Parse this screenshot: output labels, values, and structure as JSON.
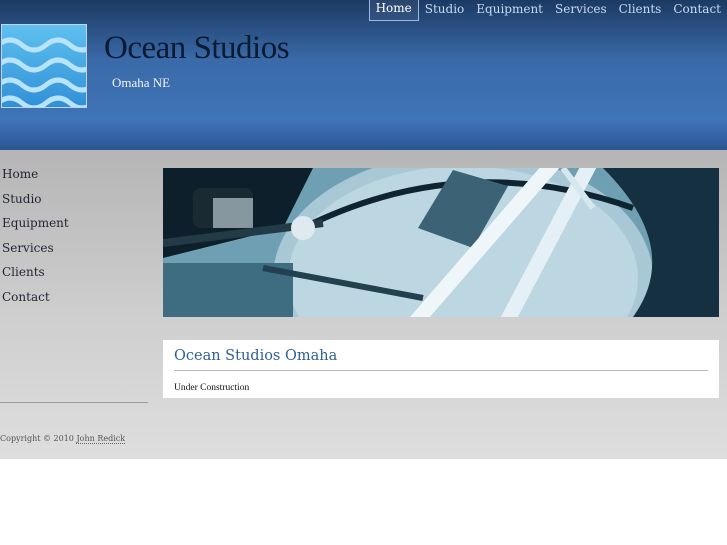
{
  "top_nav": [
    {
      "label": "Home",
      "active": true
    },
    {
      "label": "Studio"
    },
    {
      "label": "Equipment"
    },
    {
      "label": "Services"
    },
    {
      "label": "Clients"
    },
    {
      "label": "Contact"
    }
  ],
  "site": {
    "title": "Ocean Studios",
    "subtitle": "Omaha NE",
    "logo": "ocean-waves-logo"
  },
  "side_nav": [
    {
      "label": "Home"
    },
    {
      "label": "Studio"
    },
    {
      "label": "Equipment"
    },
    {
      "label": "Services"
    },
    {
      "label": "Clients"
    },
    {
      "label": "Contact"
    }
  ],
  "banner": {
    "image": "drum-kit-photo"
  },
  "main": {
    "heading": "Ocean Studios Omaha",
    "body": "Under Construction"
  },
  "footer": {
    "copyright_prefix": "Copyright © 2010",
    "author_link": "John Redick"
  },
  "colors": {
    "header_blue": "#3f74b8",
    "heading_blue": "#2f5f97",
    "nav_text": "#c9daf0"
  }
}
